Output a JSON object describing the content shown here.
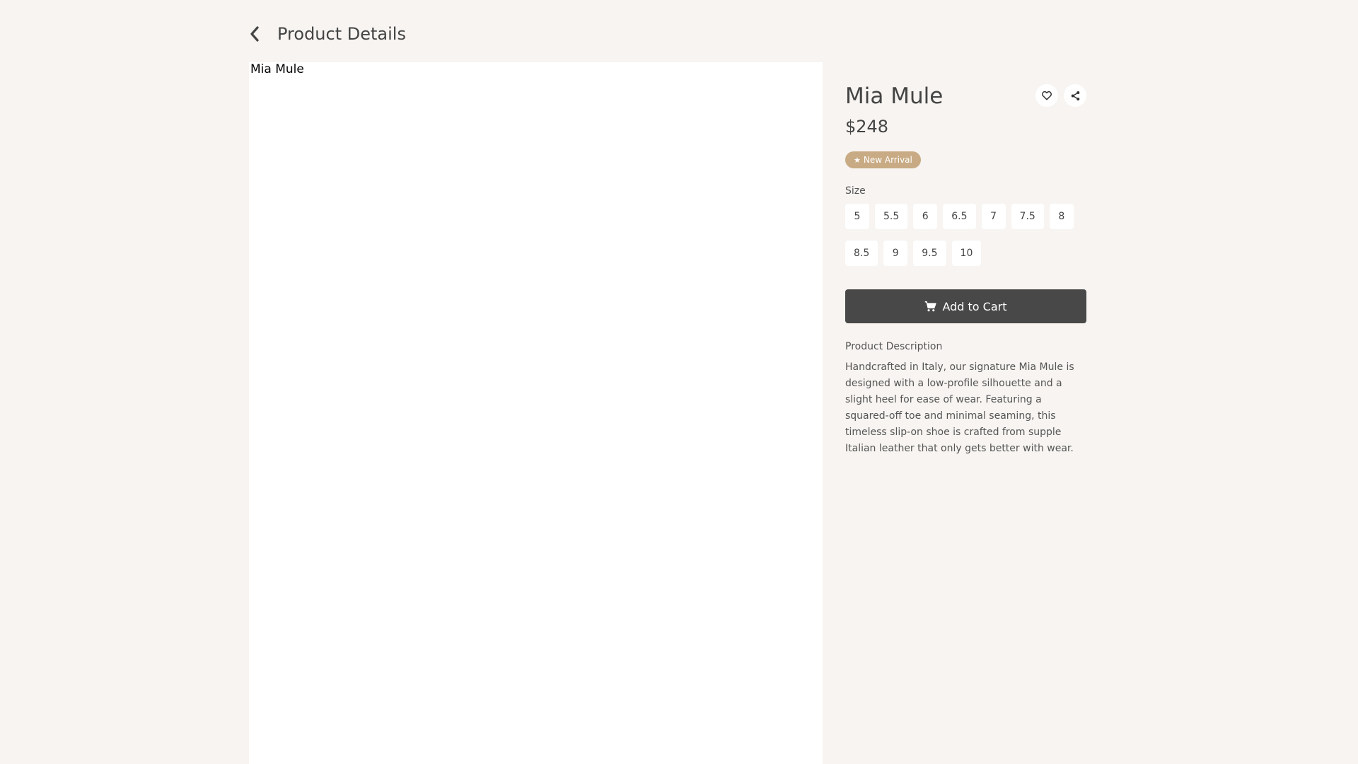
{
  "header": {
    "back_icon": "chevron-left-icon",
    "title": "Product Details"
  },
  "product": {
    "image_alt": "Mia Mule",
    "name": "Mia Mule",
    "price": "$248",
    "badge": {
      "icon": "star-icon",
      "label": "New Arrival",
      "color": "#c8ab84"
    },
    "favorite_icon": "heart-icon",
    "share_icon": "share-icon"
  },
  "size": {
    "label": "Size",
    "options_row1": [
      "5",
      "5.5",
      "6",
      "6.5",
      "7",
      "7.5",
      "8"
    ],
    "options_row2": [
      "8.5",
      "9",
      "9.5",
      "10"
    ]
  },
  "cart": {
    "icon": "cart-icon",
    "label": "Add to Cart",
    "color": "#484848"
  },
  "description": {
    "title": "Product Description",
    "text": "Handcrafted in Italy, our signature Mia Mule is designed with a low-profile silhouette and a slight heel for ease of wear. Featuring a squared-off toe and minimal seaming, this timeless slip-on shoe is crafted from supple Italian leather that only gets better with wear."
  },
  "colors": {
    "background": "#f7f4f1",
    "panel": "#ffffff",
    "text": "#444444"
  }
}
